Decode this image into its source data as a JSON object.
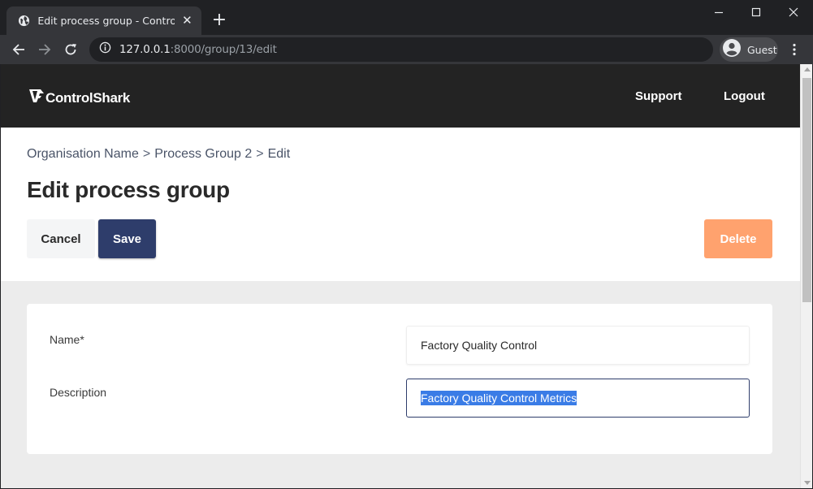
{
  "browser": {
    "tab_title": "Edit process group - ControlShark",
    "tab_close": "✕",
    "new_tab": "+",
    "url_host": "127.0.0.1",
    "url_path": ":8000/group/13/edit",
    "profile_label": "Guest"
  },
  "site": {
    "logo_text": "ControlShark",
    "nav": {
      "support": "Support",
      "logout": "Logout"
    }
  },
  "breadcrumb": {
    "organisation": "Organisation Name",
    "separator": ">",
    "group": "Process Group 2",
    "current": "Edit"
  },
  "page": {
    "title": "Edit process group"
  },
  "actions": {
    "cancel_label": "Cancel",
    "save_label": "Save",
    "delete_label": "Delete"
  },
  "form": {
    "name_label": "Name*",
    "name_value": "Factory Quality Control",
    "description_label": "Description",
    "description_value": "Factory Quality Control Metrics"
  },
  "colors": {
    "header_bg": "#232323",
    "primary": "#2e3d6b",
    "delete": "#ffa26e",
    "selection": "#3a7ce6"
  }
}
